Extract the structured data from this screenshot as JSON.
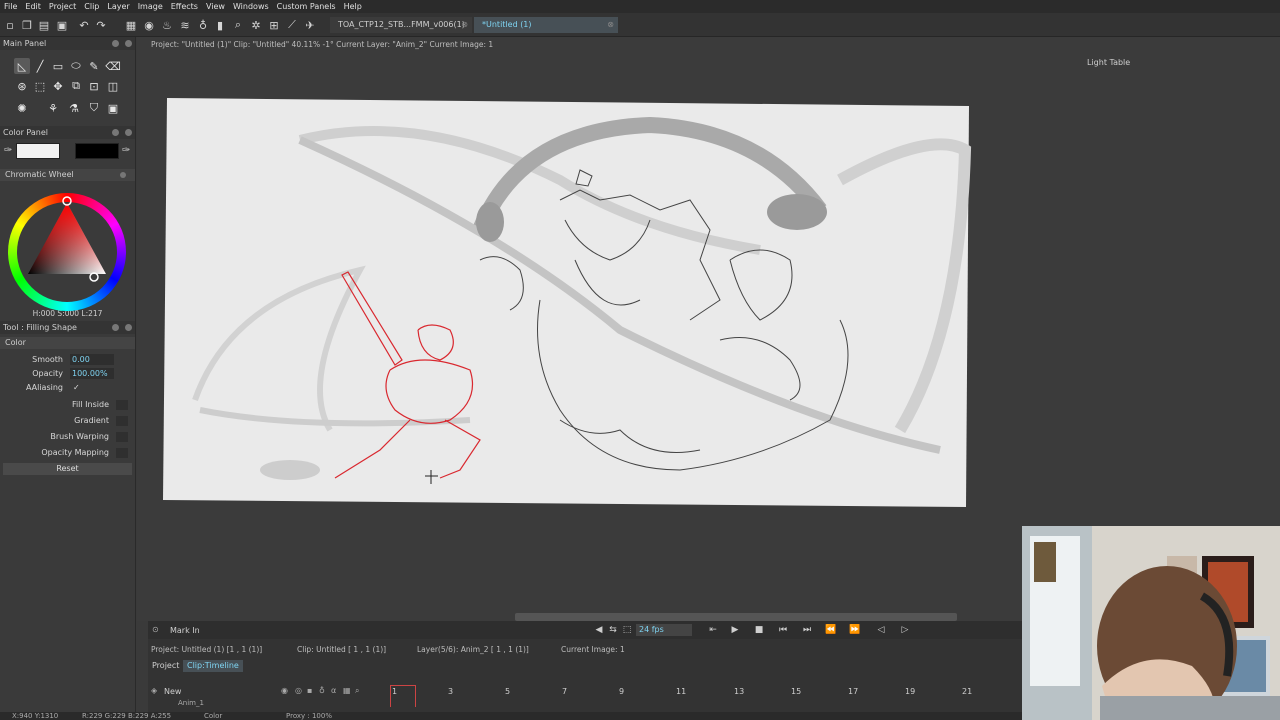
{
  "menu": [
    "File",
    "Edit",
    "Project",
    "Clip",
    "Layer",
    "Image",
    "Effects",
    "View",
    "Windows",
    "Custom Panels",
    "Help"
  ],
  "tabs": {
    "inactive": "TOA_CTP12_STB...FMM_v006(1)",
    "active": "*Untitled (1)"
  },
  "main_panel": {
    "title": "Main Panel"
  },
  "info_bar": "Project: \"Untitled (1)\"  Clip: \"Untitled\"  40.11%  -1°  Current Layer: \"Anim_2\"  Current Image: 1",
  "light_table": "Light Table",
  "color_panel": {
    "title": "Color Panel",
    "primary": "#f2f2f2",
    "secondary": "#000000"
  },
  "chromatic_wheel": {
    "title": "Chromatic Wheel",
    "readout": "H:000 S:000 L:217"
  },
  "tool_panel": {
    "title": "Tool : Filling Shape",
    "section": "Color",
    "smooth_label": "Smooth",
    "smooth_value": "0.00",
    "opacity_label": "Opacity",
    "opacity_value": "100.00%",
    "aaliasing_label": "AAliasing",
    "aaliasing_check": "✓",
    "fill_inside": "Fill Inside",
    "gradient": "Gradient",
    "brush_warping": "Brush Warping",
    "opacity_mapping": "Opacity Mapping",
    "reset": "Reset"
  },
  "timeline": {
    "mark_in": "Mark In",
    "fps": "24 fps",
    "project_info": "Project: Untitled (1) [1 , 1  (1)]",
    "clip_info": "Clip: Untitled [ 1 , 1  (1)]",
    "layer_info": "Layer(5/6): Anim_2 [ 1 , 1  (1)]",
    "current_image": "Current Image: 1",
    "tab_project": "Project",
    "tab_clip": "Clip:Timeline",
    "layer_new": "New",
    "layer_anim1": "Anim_1",
    "frames": [
      "1",
      "3",
      "5",
      "7",
      "9",
      "11",
      "13",
      "15",
      "17",
      "19",
      "21"
    ]
  },
  "status": {
    "coords": "X:940  Y:1310",
    "rgba": "R:229 G:229 B:229 A:255",
    "color": "Color",
    "proxy": "Proxy : 100%"
  },
  "colors": {
    "accent": "#7fd4f2",
    "bg": "#3a3a3a",
    "sketch_red": "#d9282f"
  }
}
